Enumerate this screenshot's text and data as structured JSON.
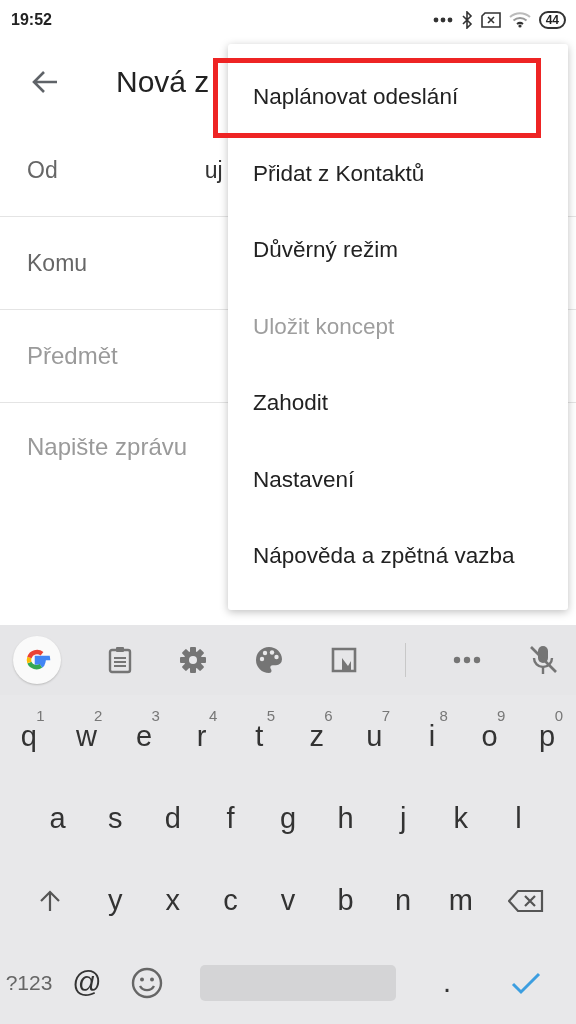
{
  "status_bar": {
    "time": "19:52",
    "battery": "44"
  },
  "app_bar": {
    "title": "Nová z"
  },
  "fields": [
    {
      "label": "Od",
      "value": "uj",
      "kind": "label"
    },
    {
      "label": "Komu",
      "kind": "label"
    },
    {
      "placeholder": "Předmět",
      "kind": "input"
    },
    {
      "placeholder": "Napište zprávu",
      "kind": "input"
    }
  ],
  "menu": {
    "items": [
      {
        "label": "Naplánovat odeslání",
        "disabled": false,
        "highlighted": true
      },
      {
        "label": "Přidat z Kontaktů",
        "disabled": false,
        "highlighted": false
      },
      {
        "label": "Důvěrný režim",
        "disabled": false,
        "highlighted": false
      },
      {
        "label": "Uložit koncept",
        "disabled": true,
        "highlighted": false
      },
      {
        "label": "Zahodit",
        "disabled": false,
        "highlighted": false
      },
      {
        "label": "Nastavení",
        "disabled": false,
        "highlighted": false
      },
      {
        "label": "Nápověda a zpětná vazba",
        "disabled": false,
        "highlighted": false
      }
    ]
  },
  "keyboard": {
    "rows": [
      {
        "keys": [
          {
            "kind": "char",
            "label": "q",
            "hint": "1"
          },
          {
            "kind": "char",
            "label": "w",
            "hint": "2"
          },
          {
            "kind": "char",
            "label": "e",
            "hint": "3"
          },
          {
            "kind": "char",
            "label": "r",
            "hint": "4"
          },
          {
            "kind": "char",
            "label": "t",
            "hint": "5"
          },
          {
            "kind": "char",
            "label": "z",
            "hint": "6"
          },
          {
            "kind": "char",
            "label": "u",
            "hint": "7"
          },
          {
            "kind": "char",
            "label": "i",
            "hint": "8"
          },
          {
            "kind": "char",
            "label": "o",
            "hint": "9"
          },
          {
            "kind": "char",
            "label": "p",
            "hint": "0"
          }
        ]
      },
      {
        "keys": [
          {
            "kind": "char",
            "label": "a"
          },
          {
            "kind": "char",
            "label": "s"
          },
          {
            "kind": "char",
            "label": "d"
          },
          {
            "kind": "char",
            "label": "f"
          },
          {
            "kind": "char",
            "label": "g"
          },
          {
            "kind": "char",
            "label": "h"
          },
          {
            "kind": "char",
            "label": "j"
          },
          {
            "kind": "char",
            "label": "k"
          },
          {
            "kind": "char",
            "label": "l"
          }
        ]
      },
      {
        "keys": [
          {
            "kind": "shift"
          },
          {
            "kind": "char",
            "label": "y"
          },
          {
            "kind": "char",
            "label": "x"
          },
          {
            "kind": "char",
            "label": "c"
          },
          {
            "kind": "char",
            "label": "v"
          },
          {
            "kind": "char",
            "label": "b"
          },
          {
            "kind": "char",
            "label": "n"
          },
          {
            "kind": "char",
            "label": "m"
          },
          {
            "kind": "backspace"
          }
        ]
      },
      {
        "keys": [
          {
            "kind": "symbols",
            "label": "?123"
          },
          {
            "kind": "char",
            "label": "@"
          },
          {
            "kind": "emoji"
          },
          {
            "kind": "space"
          },
          {
            "kind": "char",
            "label": "."
          },
          {
            "kind": "enter"
          }
        ]
      }
    ]
  }
}
